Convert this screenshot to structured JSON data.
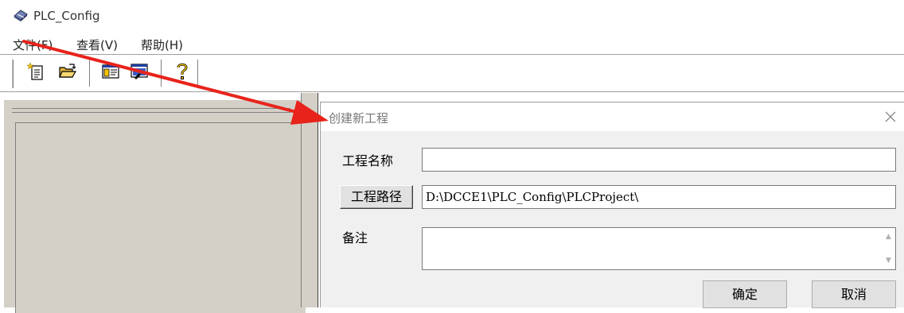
{
  "app": {
    "title": "PLC_Config",
    "icon": "app-logo-icon"
  },
  "menu": {
    "items": [
      {
        "label": "文件(F)"
      },
      {
        "label": "查看(V)"
      },
      {
        "label": "帮助(H)"
      }
    ]
  },
  "toolbar": {
    "buttons": [
      {
        "name": "new-project-icon"
      },
      {
        "name": "open-folder-icon"
      },
      {
        "name": "panel-layout-icon"
      },
      {
        "name": "output-window-icon"
      },
      {
        "name": "help-icon"
      }
    ]
  },
  "left_panel": {
    "close_glyph": "×"
  },
  "dialog": {
    "title": "创建新工程",
    "close_glyph": "×",
    "project_name_label": "工程名称",
    "project_name_value": "",
    "path_button_label": "工程路径",
    "path_value": "D:\\DCCE1\\PLC_Config\\PLCProject\\",
    "notes_label": "备注",
    "notes_value": "",
    "ok_label": "确定",
    "cancel_label": "取消"
  },
  "annotation": {
    "color": "#e8231b",
    "type": "arrow"
  }
}
